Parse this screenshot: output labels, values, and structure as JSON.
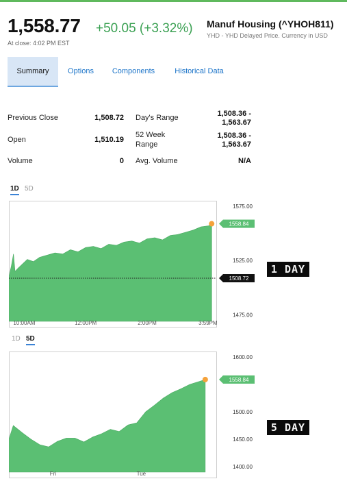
{
  "header": {
    "price": "1,558.77",
    "change": "+50.05 (+3.32%)",
    "close_time": "At close: 4:02 PM EST",
    "name": "Manuf Housing (^YHOH811)",
    "subtitle": "YHD - YHD Delayed Price. Currency in USD"
  },
  "colors": {
    "accent_green": "#3aa052",
    "chart_fill": "#5bbf73",
    "link_blue": "#1a73c8",
    "marker_orange": "#f5a23a"
  },
  "tabs": [
    {
      "label": "Summary",
      "active": true
    },
    {
      "label": "Options",
      "active": false
    },
    {
      "label": "Components",
      "active": false
    },
    {
      "label": "Historical Data",
      "active": false
    }
  ],
  "stats": {
    "previous_close": {
      "label": "Previous Close",
      "value": "1,508.72"
    },
    "open": {
      "label": "Open",
      "value": "1,510.19"
    },
    "volume": {
      "label": "Volume",
      "value": "0"
    },
    "days_range": {
      "label": "Day's Range",
      "value_line1": "1,508.36 -",
      "value_line2": "1,563.67"
    },
    "week52_range": {
      "label_line1": "52 Week",
      "label_line2": "Range",
      "value_line1": "1,508.36 -",
      "value_line2": "1,563.67"
    },
    "avg_volume": {
      "label": "Avg. Volume",
      "value": "N/A"
    }
  },
  "chart1": {
    "range_tabs": [
      "1D",
      "5D"
    ],
    "active_range": "1D",
    "stamp": "1 DAY",
    "price_badge": "1558.84",
    "prev_close_badge": "1508.72"
  },
  "chart2": {
    "range_tabs": [
      "1D",
      "5D"
    ],
    "active_range": "5D",
    "stamp": "5 DAY",
    "price_badge": "1558.84"
  },
  "chart_data": [
    {
      "type": "area",
      "yticks": [
        "1575.00",
        "1525.00",
        "1475.00"
      ],
      "ytick_values": [
        1575,
        1525,
        1475
      ],
      "ylim": [
        1469,
        1580
      ],
      "xticks": [
        "10:00AM",
        "12:00PM",
        "2:00PM",
        "3:59PM"
      ],
      "xtick_values": [
        0.5,
        2.5,
        4.5,
        6.48
      ],
      "xlim": [
        0,
        6.75
      ],
      "reference_line": 1508.72,
      "last_value": 1558.84,
      "series": [
        {
          "x": [
            0,
            0.08,
            0.15,
            0.2,
            0.3,
            0.45,
            0.6,
            0.8,
            1.0,
            1.25,
            1.5,
            1.75,
            2.0,
            2.25,
            2.5,
            2.75,
            3.0,
            3.25,
            3.5,
            3.75,
            4.0,
            4.25,
            4.5,
            4.75,
            5.0,
            5.25,
            5.5,
            5.75,
            6.0,
            6.25,
            6.5,
            6.6
          ],
          "values": [
            1510,
            1520,
            1531,
            1515,
            1518,
            1522,
            1526,
            1524,
            1528,
            1530,
            1532,
            1531,
            1535,
            1533,
            1537,
            1538,
            1536,
            1540,
            1539,
            1542,
            1543,
            1541,
            1545,
            1546,
            1544,
            1548,
            1549,
            1551,
            1553,
            1556,
            1557,
            1558.84
          ]
        }
      ]
    },
    {
      "type": "area",
      "yticks": [
        "1600.00",
        "1500.00",
        "1450.00",
        "1400.00"
      ],
      "ytick_values": [
        1600,
        1500,
        1450,
        1400
      ],
      "ylim": [
        1390,
        1610
      ],
      "xticks": [
        "Fri",
        "Tue"
      ],
      "xtick_values": [
        1,
        3
      ],
      "xlim": [
        0,
        4.7
      ],
      "last_value": 1558.84,
      "series": [
        {
          "x": [
            0,
            0.1,
            0.3,
            0.5,
            0.7,
            0.9,
            1.1,
            1.3,
            1.5,
            1.7,
            1.9,
            2.1,
            2.3,
            2.5,
            2.7,
            2.9,
            3.1,
            3.3,
            3.5,
            3.7,
            3.9,
            4.1,
            4.3,
            4.45
          ],
          "values": [
            1450,
            1475,
            1462,
            1450,
            1440,
            1436,
            1446,
            1452,
            1452,
            1445,
            1454,
            1460,
            1468,
            1464,
            1476,
            1480,
            1500,
            1512,
            1525,
            1535,
            1542,
            1550,
            1555,
            1558.84
          ]
        }
      ]
    }
  ]
}
